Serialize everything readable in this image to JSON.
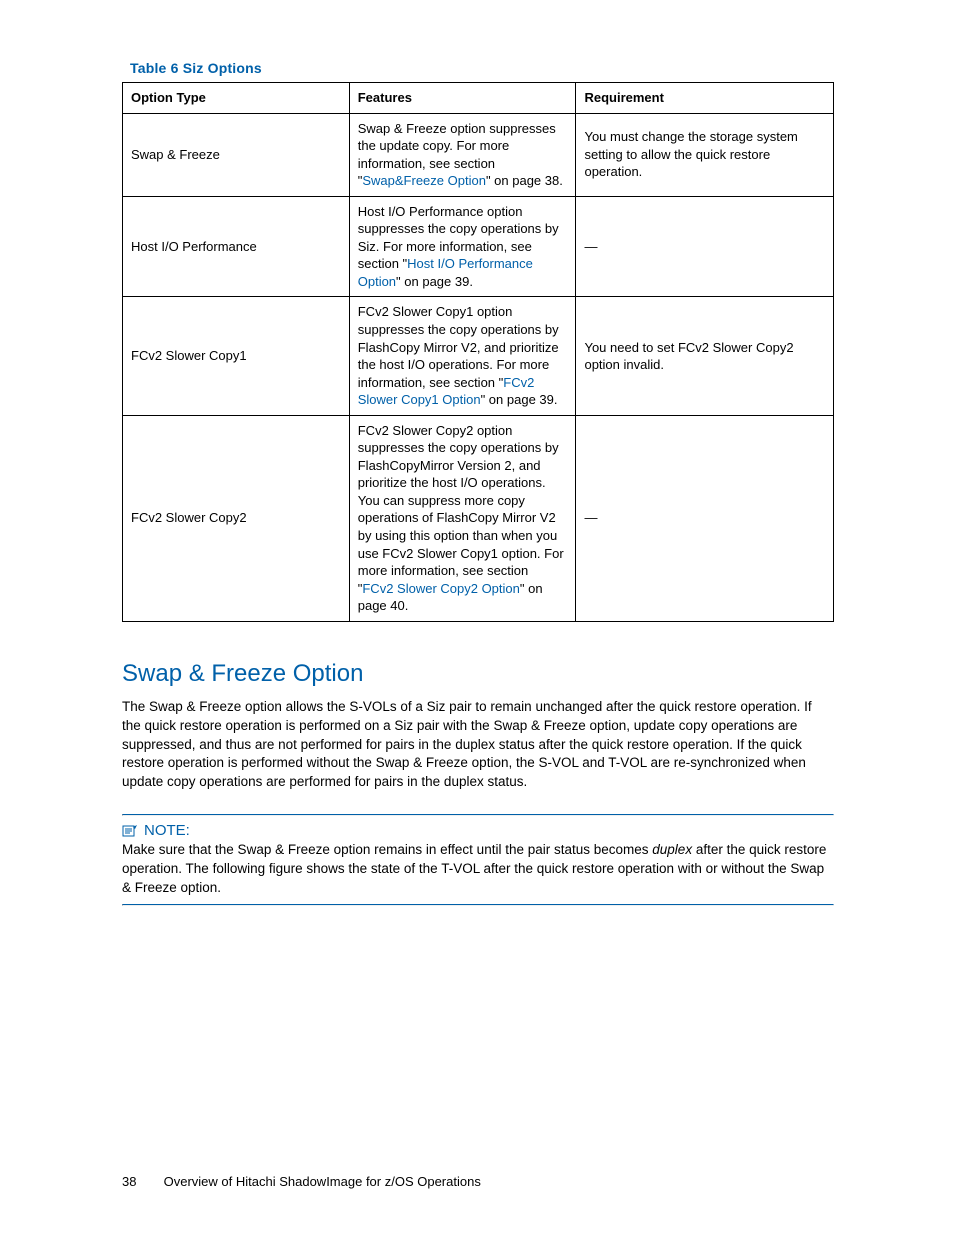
{
  "table": {
    "caption": "Table 6 Siz Options",
    "headers": [
      "Option Type",
      "Features",
      "Requirement"
    ],
    "rows": [
      {
        "option": "Swap & Freeze",
        "feat_pre": "Swap & Freeze option suppresses the update copy.  For more information, see section \"",
        "feat_link": "Swap&Freeze Option",
        "feat_post": "\" on page 38.",
        "req": "You must change the storage system setting to allow the quick restore operation."
      },
      {
        "option": "Host I/O Performance",
        "feat_pre": "Host I/O Performance option suppresses the copy operations by Siz.  For more information, see section \"",
        "feat_link": "Host I/O Performance Option",
        "feat_post": "\" on page 39.",
        "req": "—"
      },
      {
        "option": "FCv2 Slower Copy1",
        "feat_pre": "FCv2 Slower Copy1 option suppresses the copy operations by FlashCopy Mirror V2, and prioritize the host I/O operations.  For more information, see section \"",
        "feat_link": "FCv2 Slower Copy1 Option",
        "feat_post": "\" on page 39.",
        "req": "You need to set FCv2 Slower Copy2 option invalid."
      },
      {
        "option": "FCv2 Slower Copy2",
        "feat_pre": "FCv2 Slower Copy2 option suppresses the copy operations by FlashCopyMirror Version 2, and prioritize the host I/O operations.  You can suppress more copy operations of FlashCopy Mirror V2 by using this option than when you use FCv2 Slower Copy1 option.  For more information, see section \"",
        "feat_link": "FCv2 Slower Copy2 Option",
        "feat_post": "\" on page 40.",
        "req": "—"
      }
    ]
  },
  "section": {
    "title": "Swap & Freeze Option",
    "body": "The Swap & Freeze option allows the S-VOLs of a Siz pair to remain unchanged after the quick restore operation.  If the quick restore operation is performed on a Siz pair with the Swap & Freeze option, update copy operations are suppressed, and thus are not performed for pairs in the duplex status after the quick restore operation.  If the quick restore operation is performed without the Swap & Freeze option, the S-VOL and T-VOL are re-synchronized when update copy operations are performed for pairs in the duplex status."
  },
  "note": {
    "label": "NOTE:",
    "pre": "Make sure that the Swap & Freeze option remains in effect until the pair status becomes ",
    "italic": "duplex",
    "post": " after the quick restore operation.  The following figure shows the state of the T-VOL after the quick restore operation with or without the Swap & Freeze option."
  },
  "footer": {
    "page": "38",
    "title": "Overview of Hitachi ShadowImage for z/OS Operations"
  }
}
